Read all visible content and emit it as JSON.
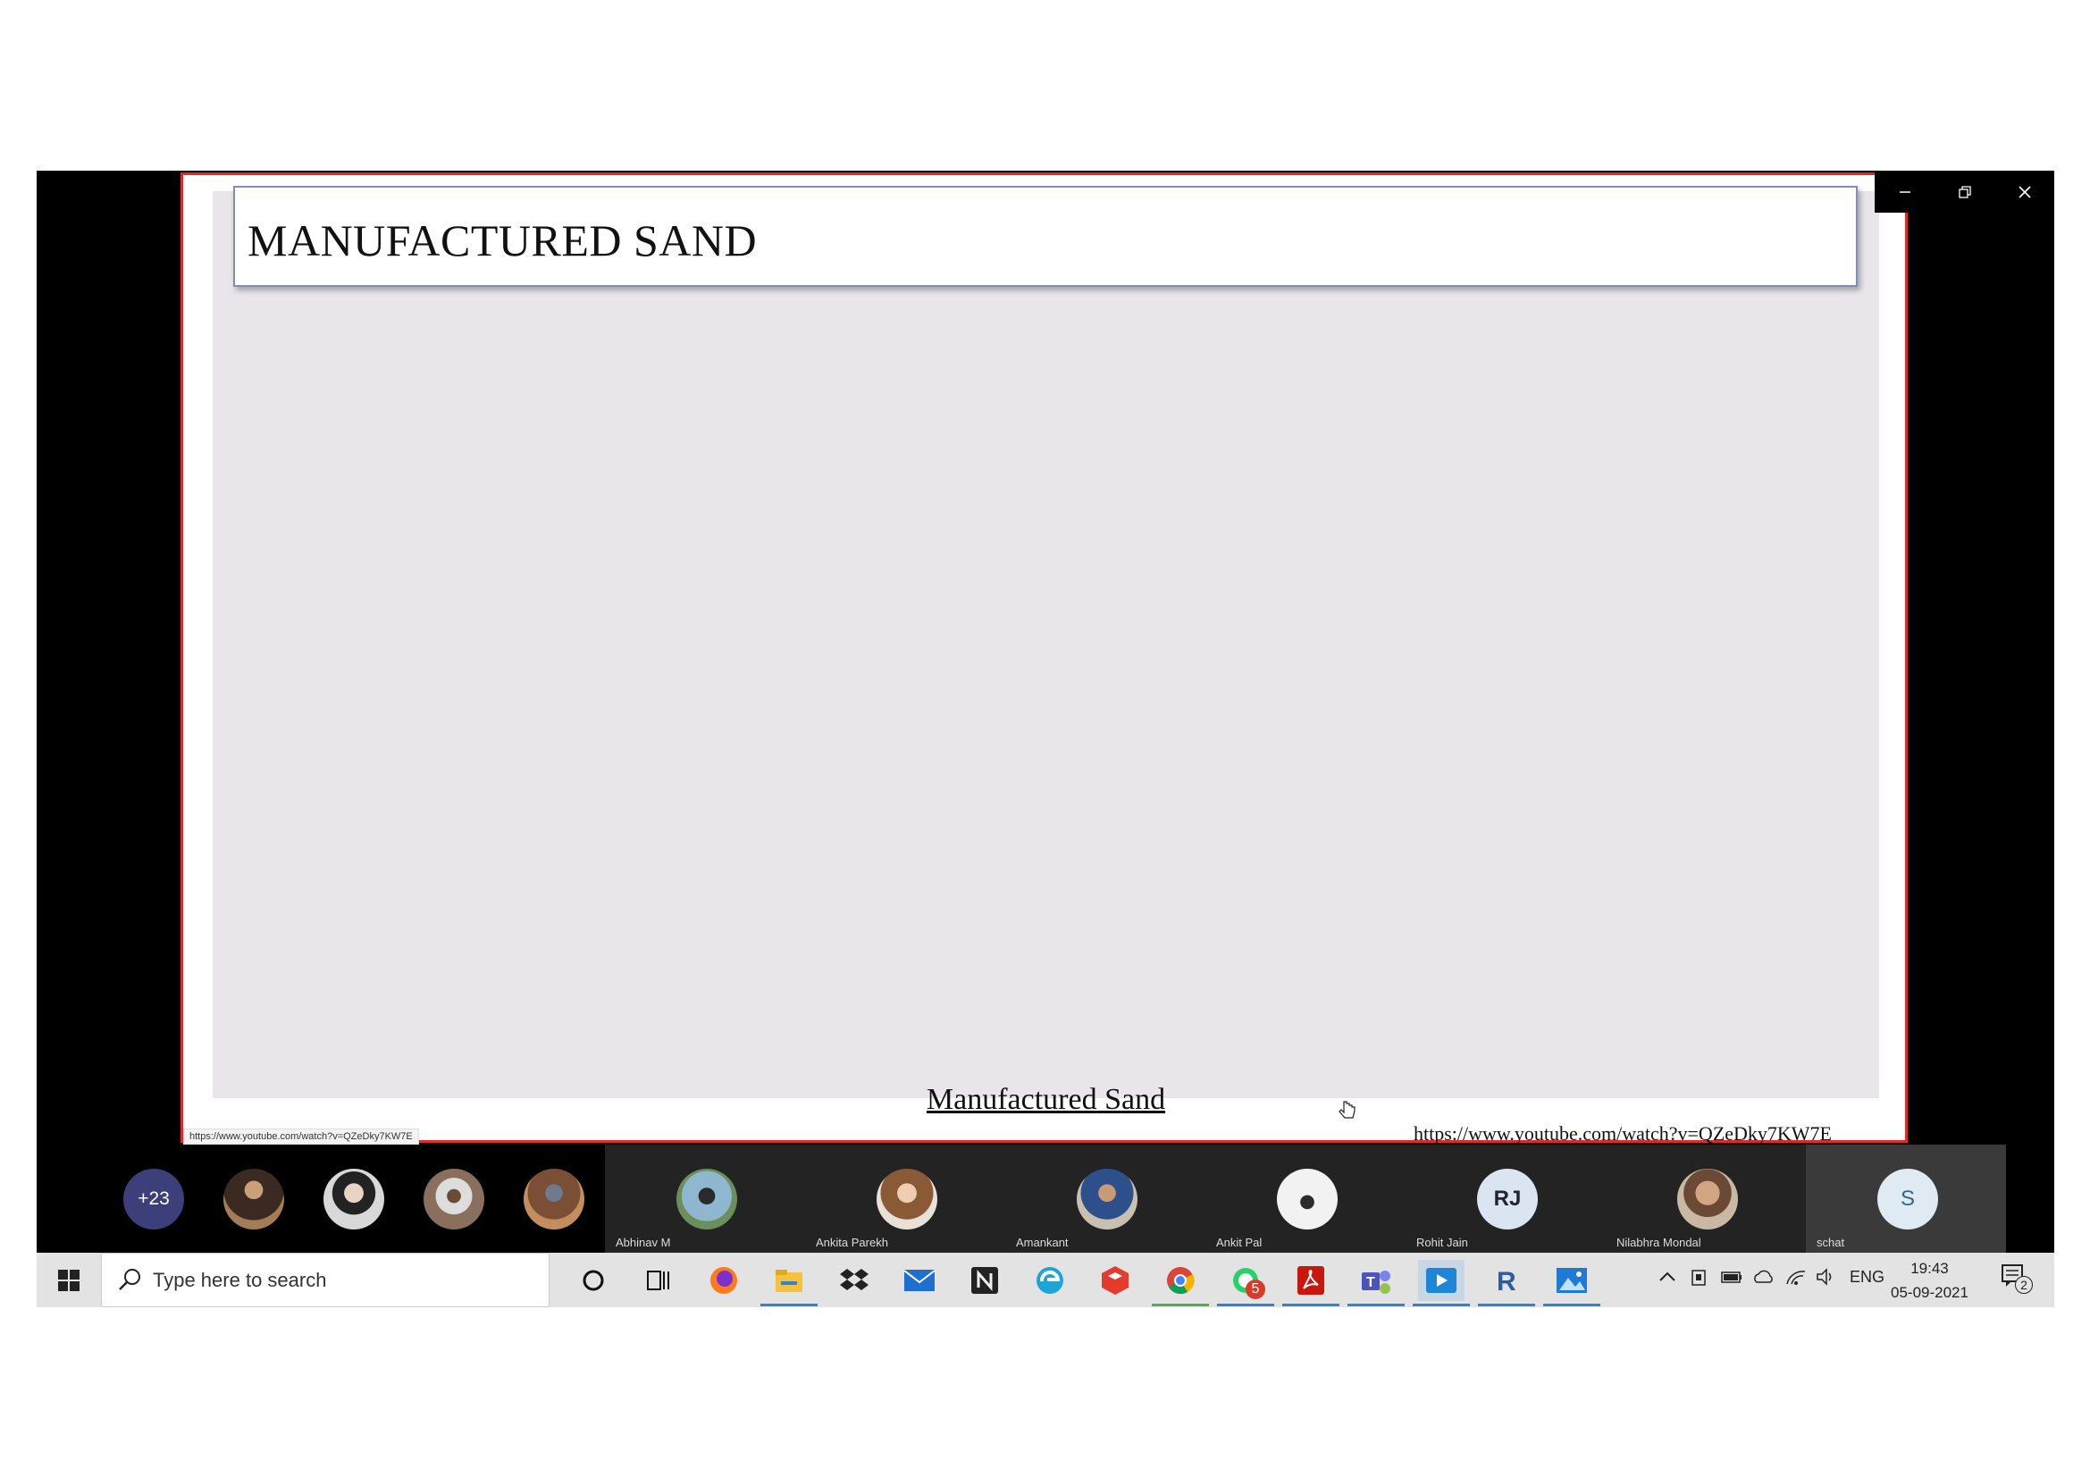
{
  "slide": {
    "title": "MANUFACTURED SAND",
    "link_text": "Manufactured Sand",
    "source_url": "https://www.youtube.com/watch?v=QZeDky7KW7E",
    "status_url": "https://www.youtube.com/watch?v=QZeDky7KW7E"
  },
  "window_controls": {
    "minimize": "minimize-icon",
    "restore": "restore-icon",
    "close": "close-icon"
  },
  "participants": {
    "more_count": "+23",
    "tiles": [
      {
        "name": "Abhinav M"
      },
      {
        "name": "Ankita Parekh"
      },
      {
        "name": "Amankant"
      },
      {
        "name": "Ankit Pal"
      },
      {
        "name": "Rohit Jain",
        "initials": "RJ"
      },
      {
        "name": "Nilabhra Mondal"
      },
      {
        "name": "schat",
        "initials": "S"
      }
    ]
  },
  "taskbar": {
    "search_placeholder": "Type here to search",
    "whatsapp_badge": "5",
    "apps": [
      "cortana-icon",
      "task-view-icon",
      "firefox-icon",
      "file-explorer-icon",
      "dropbox-icon",
      "mail-icon",
      "notion-icon",
      "edge-icon",
      "sketchup-icon",
      "chrome-icon",
      "whatsapp-icon",
      "acrobat-icon",
      "teams-icon",
      "media-player-icon",
      "revit-icon",
      "photos-icon"
    ]
  },
  "tray": {
    "language": "ENG",
    "time": "19:43",
    "date": "05-09-2021",
    "notification_count": "2"
  }
}
